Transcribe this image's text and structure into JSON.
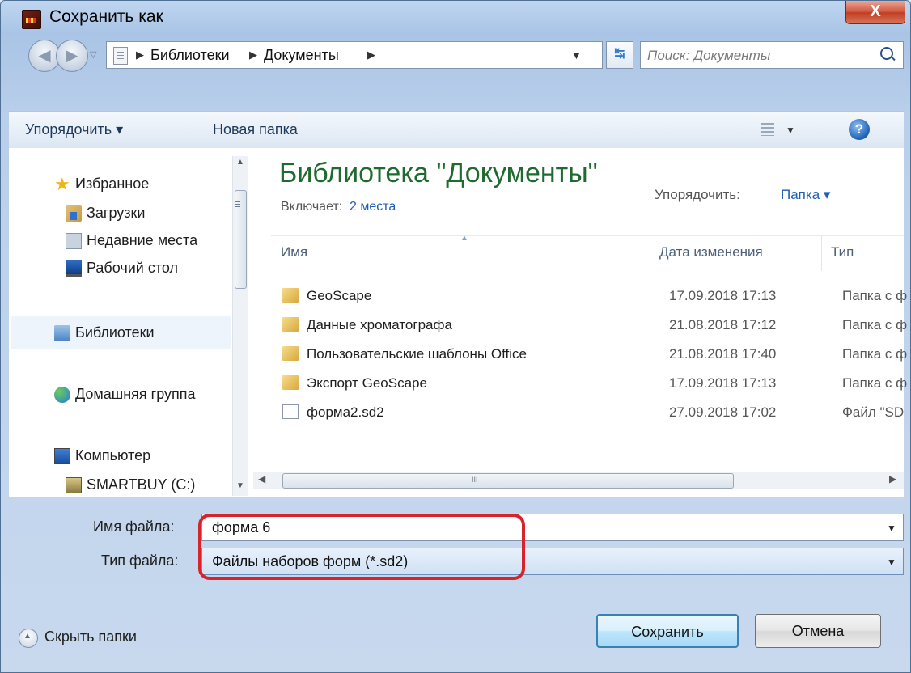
{
  "window": {
    "title": "Сохранить как",
    "close_label": "X"
  },
  "address": {
    "crumbs": [
      "Библиотеки",
      "Документы"
    ],
    "search_placeholder": "Поиск: Документы"
  },
  "toolbar": {
    "organize": "Упорядочить ▾",
    "new_folder": "Новая папка"
  },
  "nav": {
    "items": [
      {
        "label": "Избранное",
        "icon": "star-icon"
      },
      {
        "label": "Загрузки",
        "icon": "downloads-icon"
      },
      {
        "label": "Недавние места",
        "icon": "recent-places-icon"
      },
      {
        "label": "Рабочий стол",
        "icon": "desktop-icon"
      },
      {
        "label": "Библиотеки",
        "icon": "libraries-icon"
      },
      {
        "label": "Домашняя группа",
        "icon": "homegroup-icon"
      },
      {
        "label": "Компьютер",
        "icon": "computer-icon"
      },
      {
        "label": "SMARTBUY (C:)",
        "icon": "drive-icon"
      }
    ]
  },
  "library": {
    "title": "Библиотека \"Документы\"",
    "includes_label": "Включает:",
    "includes_link": "2 места",
    "arrange_label": "Упорядочить:",
    "arrange_value": "Папка ▾"
  },
  "columns": {
    "name": "Имя",
    "date": "Дата изменения",
    "type": "Тип"
  },
  "files": [
    {
      "name": "GeoScape",
      "date": "17.09.2018 17:13",
      "type": "Папка с ф",
      "kind": "folder"
    },
    {
      "name": "Данные хроматографа",
      "date": "21.08.2018 17:12",
      "type": "Папка с ф",
      "kind": "folder"
    },
    {
      "name": "Пользовательские шаблоны Office",
      "date": "21.08.2018 17:40",
      "type": "Папка с ф",
      "kind": "folder"
    },
    {
      "name": "Экспорт GeoScape",
      "date": "17.09.2018 17:13",
      "type": "Папка с ф",
      "kind": "folder"
    },
    {
      "name": "форма2.sd2",
      "date": "27.09.2018 17:02",
      "type": "Файл \"SD",
      "kind": "file"
    }
  ],
  "form": {
    "filename_label": "Имя файла:",
    "filename_value": "форма 6",
    "filetype_label": "Тип файла:",
    "filetype_value": "Файлы наборов форм  (*.sd2)"
  },
  "footer": {
    "hide_folders": "Скрыть папки",
    "save": "Сохранить",
    "cancel": "Отмена"
  },
  "colors": {
    "accent_highlight": "#d8232a",
    "library_title": "#1f6a2e",
    "link": "#1e5fb4"
  }
}
